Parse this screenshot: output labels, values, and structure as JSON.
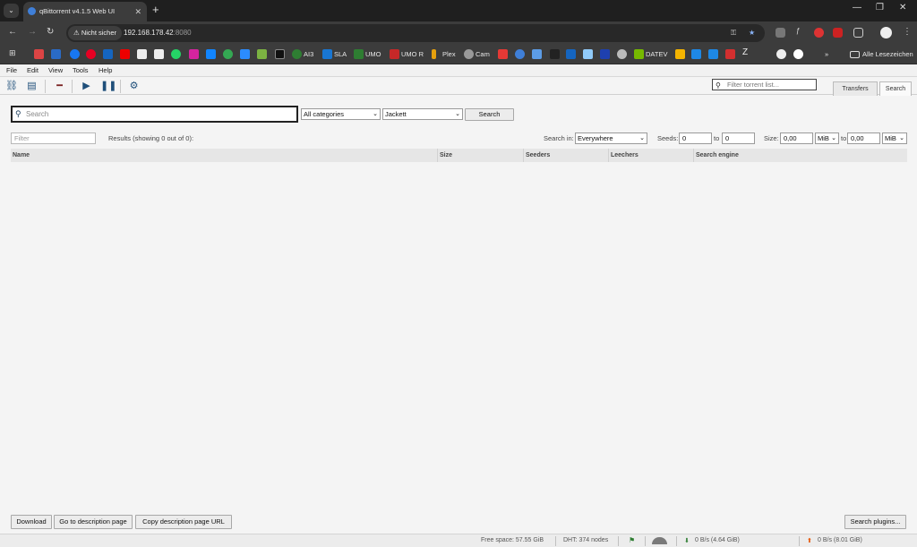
{
  "browser": {
    "tab_title": "qBittorrent v4.1.5 Web UI",
    "security_chip": "Nicht sicher",
    "url_host": "192.168.178.42",
    "url_port": ":8080",
    "bookmarks_label": "Alle Lesezeichen",
    "bookmarks": [
      {
        "label": "AI3"
      },
      {
        "label": "SLA"
      },
      {
        "label": "UMO"
      },
      {
        "label": "UMO R"
      },
      {
        "label": "Plex"
      },
      {
        "label": "Cam"
      },
      {
        "label": "DATEV"
      }
    ]
  },
  "menu": [
    "File",
    "Edit",
    "View",
    "Tools",
    "Help"
  ],
  "toolbar": {
    "filter_placeholder": "Filter torrent list...",
    "tabs": [
      "Transfers",
      "Search"
    ]
  },
  "search": {
    "placeholder": "Search",
    "category": "All categories",
    "plugin": "Jackett",
    "button": "Search",
    "filter_placeholder": "Filter",
    "results_text": "Results (showing 0 out of 0):",
    "search_in_label": "Search in:",
    "search_in_value": "Everywhere",
    "seeds_label": "Seeds:",
    "seeds_from": "0",
    "seeds_to_label": "to",
    "seeds_to": "0",
    "size_label": "Size:",
    "size_from": "0,00",
    "size_from_unit": "MiB",
    "size_to_label": "to",
    "size_to": "0,00",
    "size_to_unit": "MiB"
  },
  "table": {
    "columns": [
      "Name",
      "Size",
      "Seeders",
      "Leechers",
      "Search engine"
    ]
  },
  "actions": {
    "download": "Download",
    "goto_desc": "Go to description page",
    "copy_url": "Copy description page URL",
    "plugins": "Search plugins..."
  },
  "status": {
    "free_space": "Free space: 57.55 GiB",
    "dht": "DHT: 374 nodes",
    "download": "0 B/s (4.64 GiB)",
    "upload": "0 B/s (8.01 GiB)"
  }
}
